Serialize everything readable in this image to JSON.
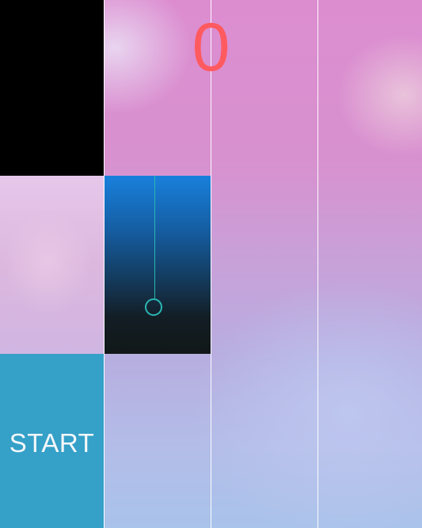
{
  "game": {
    "score": "0",
    "start_label": "START",
    "colors": {
      "score": "#ff5a5f",
      "start_tile": "#35a0c8",
      "black_tile": "#000000",
      "long_tile_top": "#1880dc",
      "long_tile_bottom": "#121818",
      "hold_indicator": "#2ab7b3",
      "lane_divider": "#ffffff"
    }
  }
}
